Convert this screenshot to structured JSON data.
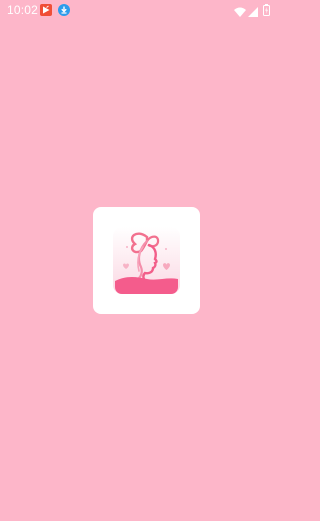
{
  "status_bar": {
    "time": "10:02",
    "icons": [
      "video-app-notification-icon",
      "download-notification-icon",
      "wifi-icon",
      "cellular-signal-icon",
      "battery-icon"
    ]
  },
  "splash": {
    "background_color": "#FDB6C9",
    "logo_icon": "woman-silhouette-butterfly-logo-icon",
    "accent_color": "#F45C8C"
  }
}
